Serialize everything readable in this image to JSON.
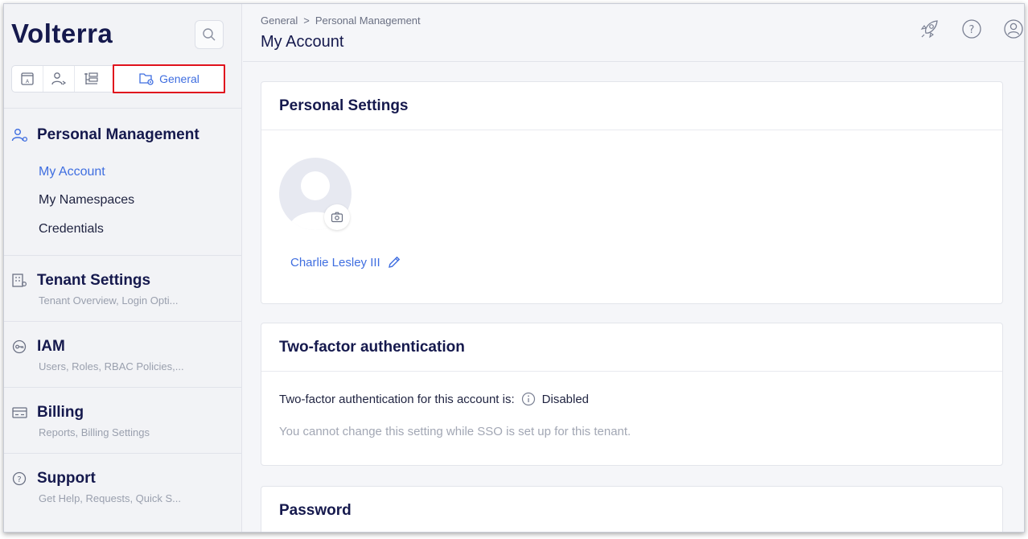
{
  "app": {
    "logo_text": "Volterra"
  },
  "sidebar": {
    "tabs": [
      {
        "icon": "app-icon"
      },
      {
        "icon": "user-settings-icon"
      },
      {
        "icon": "tree-icon"
      },
      {
        "icon": "folder-gear-icon",
        "label": "General"
      }
    ],
    "personal_management": {
      "title": "Personal Management",
      "items": [
        {
          "label": "My Account",
          "active": true
        },
        {
          "label": "My Namespaces"
        },
        {
          "label": "Credentials"
        }
      ]
    },
    "sections": [
      {
        "title": "Tenant Settings",
        "subtitle": "Tenant Overview, Login Opti...",
        "icon": "building-icon"
      },
      {
        "title": "IAM",
        "subtitle": "Users, Roles, RBAC Policies,...",
        "icon": "key-icon"
      },
      {
        "title": "Billing",
        "subtitle": "Reports, Billing Settings",
        "icon": "card-icon"
      },
      {
        "title": "Support",
        "subtitle": "Get Help, Requests, Quick S...",
        "icon": "question-icon"
      }
    ]
  },
  "header": {
    "breadcrumb": [
      "General",
      "Personal Management"
    ],
    "breadcrumb_separator": ">",
    "title": "My Account"
  },
  "personal_settings": {
    "title": "Personal Settings",
    "user_name": "Charlie Lesley III"
  },
  "two_factor": {
    "title": "Two-factor authentication",
    "status_label": "Two-factor authentication for this account is:",
    "status_value": "Disabled",
    "note": "You cannot change this setting while SSO is set up for this tenant."
  },
  "password": {
    "title": "Password"
  },
  "colors": {
    "accent": "#3f6ee0",
    "highlight": "#e0121d",
    "navy": "#15194d"
  }
}
